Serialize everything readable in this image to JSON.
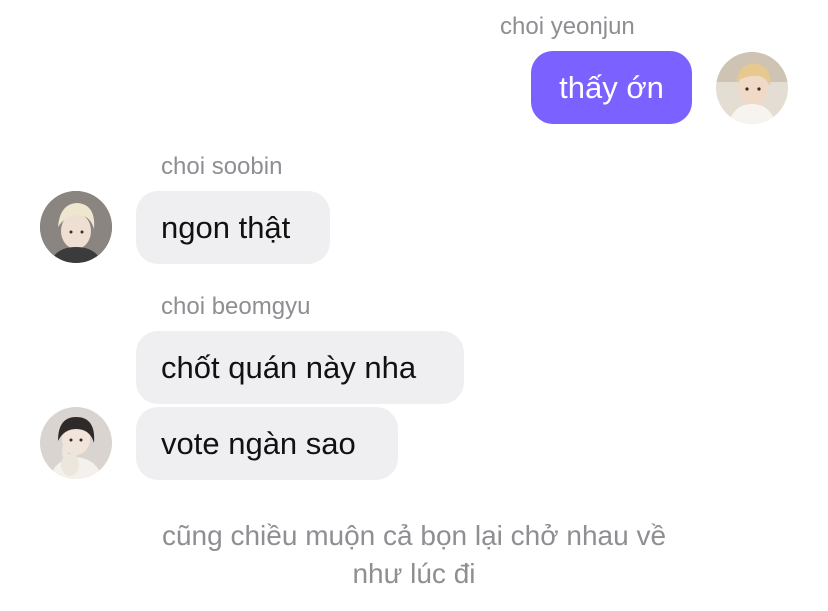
{
  "messages": [
    {
      "sender": "choi yeonjun",
      "direction": "outgoing",
      "bubbles": [
        "thấy ớn"
      ],
      "avatar_icon": "user-avatar-yeonjun"
    },
    {
      "sender": "choi soobin",
      "direction": "incoming",
      "bubbles": [
        "ngon thật"
      ],
      "avatar_icon": "user-avatar-soobin"
    },
    {
      "sender": "choi beomgyu",
      "direction": "incoming",
      "bubbles": [
        "chốt quán này nha",
        "vote ngàn sao"
      ],
      "avatar_icon": "user-avatar-beomgyu"
    }
  ],
  "system_note": {
    "line1": "cũng chiều muộn cả bọn lại chở nhau về",
    "line2": "như lúc đi"
  },
  "colors": {
    "outgoing_bubble": "#7b61ff",
    "incoming_bubble": "#efeff1",
    "meta_text": "#8e8e93"
  }
}
